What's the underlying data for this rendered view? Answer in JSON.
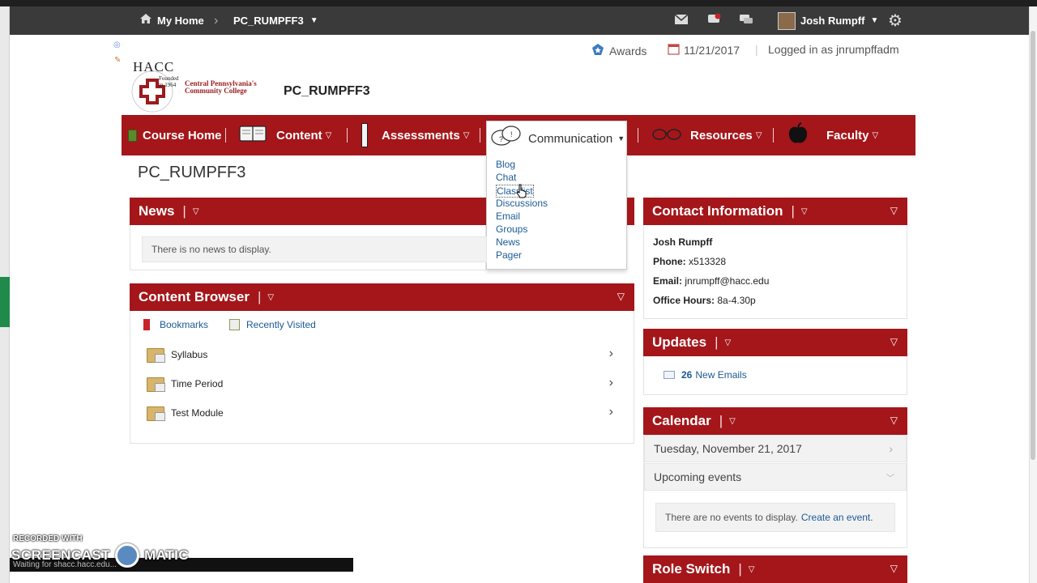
{
  "minibar": {
    "home_label": "My Home",
    "course_label": "PC_RUMPFF3",
    "user_name": "Josh Rumpff"
  },
  "header": {
    "logo_text": "HACC",
    "logo_founded": "Founded in 1964",
    "logo_college": "Central Pennsylvania's Community College",
    "course_title": "PC_RUMPFF3",
    "awards_label": "Awards",
    "date": "11/21/2017",
    "logged_in": "Logged in as jnrumpffadm"
  },
  "navbar": {
    "items": [
      {
        "label": "Course Home"
      },
      {
        "label": "Content"
      },
      {
        "label": "Assessments"
      },
      {
        "label": "Communication"
      },
      {
        "label": "Resources"
      },
      {
        "label": "Faculty"
      }
    ]
  },
  "comm_menu": {
    "items": [
      "Blog",
      "Chat",
      "Classlist",
      "Discussions",
      "Email",
      "Groups",
      "News",
      "Pager"
    ]
  },
  "page": {
    "heading": "PC_RUMPFF3"
  },
  "news": {
    "title": "News",
    "empty": "There is no news to display."
  },
  "content_browser": {
    "title": "Content Browser",
    "bookmarks": "Bookmarks",
    "recent": "Recently Visited",
    "modules": [
      "Syllabus",
      "Time Period",
      "Test Module"
    ]
  },
  "contact": {
    "title": "Contact Information",
    "name": "Josh Rumpff",
    "phone_label": "Phone:",
    "phone": "x513328",
    "email_label": "Email:",
    "email": "jnrumpff@hacc.edu",
    "hours_label": "Office Hours:",
    "hours": "8a-4.30p"
  },
  "updates": {
    "title": "Updates",
    "count": "26",
    "label": "New Emails"
  },
  "calendar": {
    "title": "Calendar",
    "date": "Tuesday, November 21, 2017",
    "upcoming": "Upcoming events",
    "empty": "There are no events to display.",
    "create": "Create an event."
  },
  "role_switch": {
    "title": "Role Switch"
  },
  "overlay": {
    "recorder_top": "RECORDED WITH",
    "recorder_name": "SCREENCAST",
    "recorder_tail": "MATIC",
    "status": "Waiting for shacc.hacc.edu..."
  },
  "colors": {
    "brand_red": "#a4161a",
    "link_blue": "#1a5a96",
    "minibar": "#3a3a3a"
  }
}
